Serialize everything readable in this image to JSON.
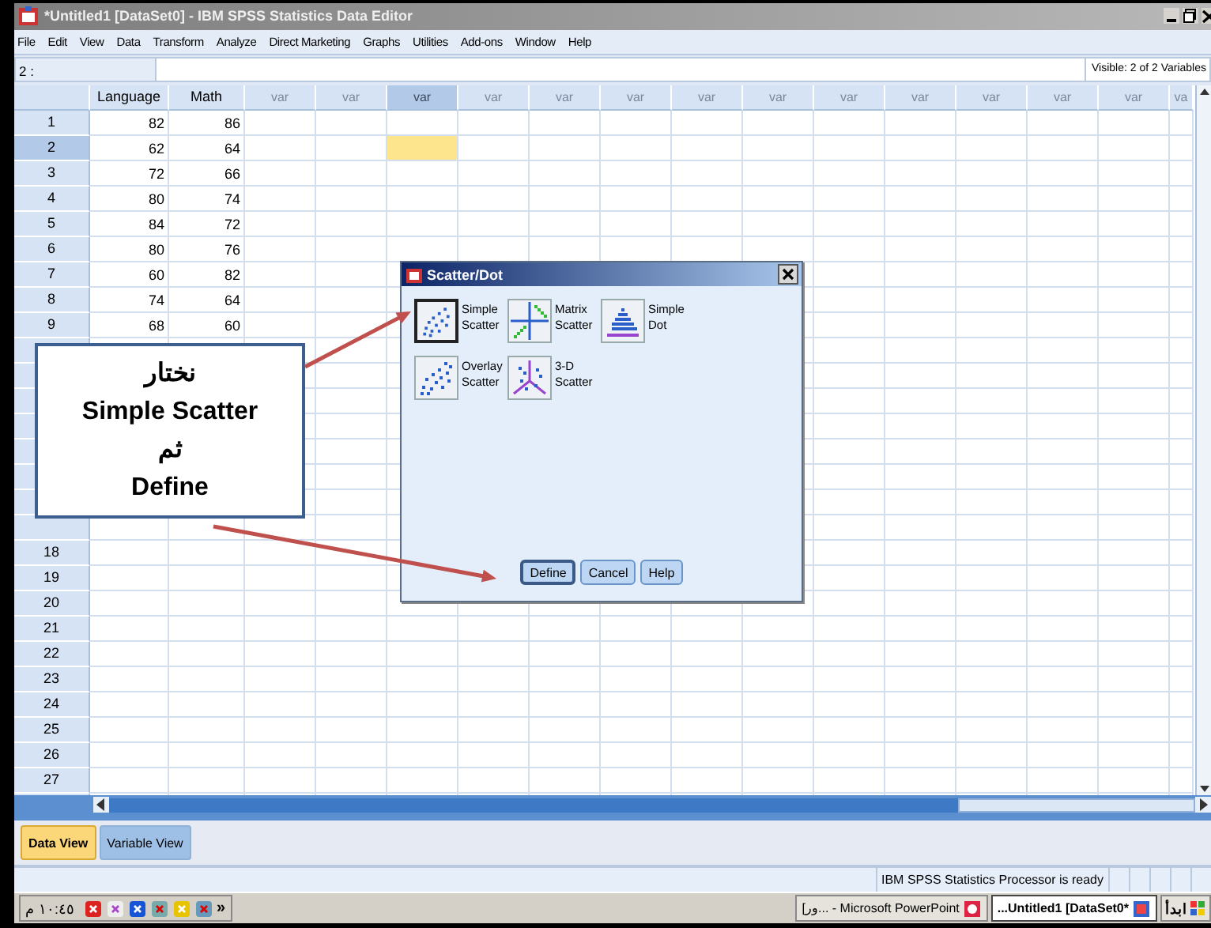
{
  "window": {
    "title": "*Untitled1 [DataSet0] - IBM SPSS Statistics Data Editor"
  },
  "menu": [
    "File",
    "Edit",
    "View",
    "Data",
    "Transform",
    "Analyze",
    "Direct Marketing",
    "Graphs",
    "Utilities",
    "Add-ons",
    "Window",
    "Help"
  ],
  "cell_editor": {
    "cell": "2 :",
    "visible": "Visible: 2 of 2 Variables"
  },
  "grid": {
    "columns": [
      {
        "label": "Language",
        "kind": "variable",
        "selected": false
      },
      {
        "label": "Math",
        "kind": "variable",
        "selected": false
      },
      {
        "label": "var",
        "kind": "empty",
        "selected": false
      },
      {
        "label": "var",
        "kind": "empty",
        "selected": false
      },
      {
        "label": "var",
        "kind": "empty",
        "selected": true
      },
      {
        "label": "var",
        "kind": "empty",
        "selected": false
      },
      {
        "label": "var",
        "kind": "empty",
        "selected": false
      },
      {
        "label": "var",
        "kind": "empty",
        "selected": false
      },
      {
        "label": "var",
        "kind": "empty",
        "selected": false
      },
      {
        "label": "var",
        "kind": "empty",
        "selected": false
      },
      {
        "label": "var",
        "kind": "empty",
        "selected": false
      },
      {
        "label": "var",
        "kind": "empty",
        "selected": false
      },
      {
        "label": "var",
        "kind": "empty",
        "selected": false
      },
      {
        "label": "var",
        "kind": "empty",
        "selected": false
      },
      {
        "label": "var",
        "kind": "empty",
        "selected": false
      },
      {
        "label": "va",
        "kind": "empty",
        "selected": false
      }
    ],
    "rows": [
      {
        "number": "1",
        "values": [
          "82",
          "86"
        ],
        "selected": false
      },
      {
        "number": "2",
        "values": [
          "62",
          "64"
        ],
        "selected": true
      },
      {
        "number": "3",
        "values": [
          "72",
          "66"
        ],
        "selected": false
      },
      {
        "number": "4",
        "values": [
          "80",
          "74"
        ],
        "selected": false
      },
      {
        "number": "5",
        "values": [
          "84",
          "72"
        ],
        "selected": false
      },
      {
        "number": "6",
        "values": [
          "80",
          "76"
        ],
        "selected": false
      },
      {
        "number": "7",
        "values": [
          "60",
          "82"
        ],
        "selected": false
      },
      {
        "number": "8",
        "values": [
          "74",
          "64"
        ],
        "selected": false
      },
      {
        "number": "9",
        "values": [
          "68",
          "60"
        ],
        "selected": false
      },
      {
        "selected": false
      },
      {
        "selected": false
      },
      {
        "selected": false
      },
      {
        "selected": false
      },
      {
        "selected": false
      },
      {
        "selected": false
      },
      {
        "selected": false
      },
      {
        "selected": false
      },
      {
        "number": "18",
        "selected": false
      },
      {
        "number": "19",
        "selected": false
      },
      {
        "number": "20",
        "selected": false
      },
      {
        "number": "21",
        "selected": false
      },
      {
        "number": "22",
        "selected": false
      },
      {
        "number": "23",
        "selected": false
      },
      {
        "number": "24",
        "selected": false
      },
      {
        "number": "25",
        "selected": false
      },
      {
        "number": "26",
        "selected": false
      },
      {
        "number": "27",
        "selected": false
      },
      {
        "selected": false
      }
    ]
  },
  "view_tabs": [
    {
      "label": "Data View",
      "selected": true
    },
    {
      "label": "Variable View",
      "selected": false
    }
  ],
  "status_bar": {
    "message": "IBM SPSS Statistics Processor is ready"
  },
  "dialog": {
    "title": "Scatter/Dot",
    "options": [
      {
        "label": "Simple Scatter",
        "kind": "simple",
        "selected": true
      },
      {
        "label": "Matrix Scatter",
        "kind": "matrix",
        "selected": false
      },
      {
        "label": "Simple Dot",
        "kind": "dot",
        "selected": false
      },
      {
        "label": "Overlay Scatter",
        "kind": "overlay",
        "selected": false
      },
      {
        "label": "3-D Scatter",
        "kind": "three_d",
        "selected": false
      }
    ],
    "buttons": [
      {
        "label": "Define",
        "default": true
      },
      {
        "label": "Cancel",
        "default": false
      },
      {
        "label": "Help",
        "default": false
      }
    ]
  },
  "callout": {
    "text": "نختار\nSimple Scatter\nثم\nDefine"
  },
  "taskbar": {
    "clock": "١٠:٤٥ م",
    "overflow": "»",
    "tasks": [
      {
        "label": "[ور... - Microsoft PowerPoint",
        "kind": "powerpoint",
        "selected": false
      },
      {
        "label": "...Untitled1 [DataSet0*",
        "kind": "spss",
        "selected": true
      }
    ],
    "start": "ابدأ"
  }
}
